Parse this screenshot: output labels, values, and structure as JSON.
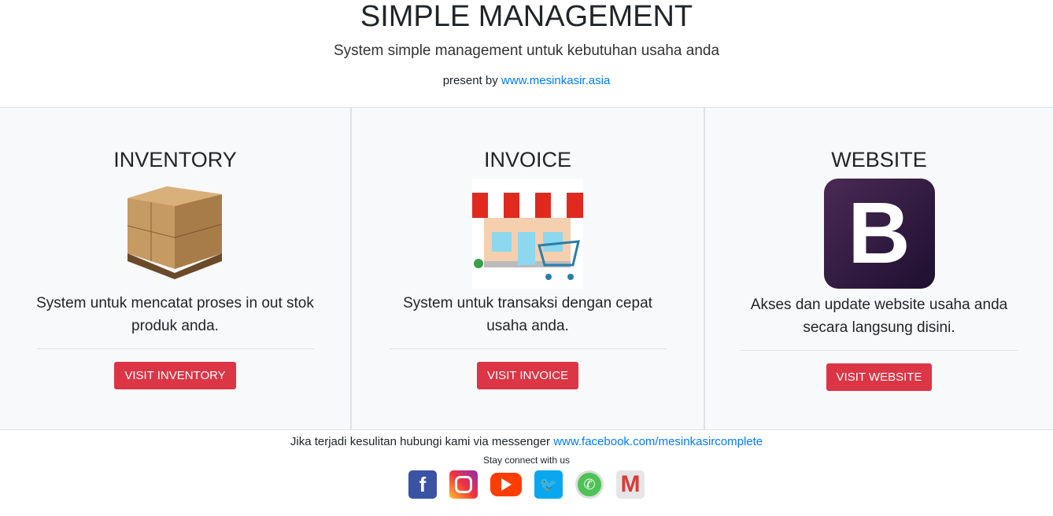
{
  "header": {
    "title": "SIMPLE MANAGEMENT",
    "subtitle": "System simple management untuk kebutuhan usaha anda",
    "present_by": "present by",
    "link": "www.mesinkasir.asia"
  },
  "cards": [
    {
      "title": "INVENTORY",
      "desc": "System untuk mencatat proses in out stok produk anda.",
      "button": "VISIT INVENTORY",
      "image": "boxes-on-pallet"
    },
    {
      "title": "INVOICE",
      "desc": "System untuk transaksi dengan cepat usaha anda.",
      "button": "VISIT INVOICE",
      "image": "store-with-cart"
    },
    {
      "title": "WEBSITE",
      "desc": "Akses dan update website usaha anda secara langsung disini.",
      "button": "VISIT WEBSITE",
      "image": "bootstrap-logo",
      "logo_letter": "B"
    }
  ],
  "footer": {
    "contact_text": "Jika terjadi kesulitan hubungi kami via messenger",
    "contact_link": "www.facebook.com/mesinkasircomplete",
    "stay": "Stay connect with us",
    "social": [
      "facebook-icon",
      "instagram-icon",
      "youtube-icon",
      "twitter-icon",
      "whatsapp-icon",
      "gmail-icon"
    ]
  },
  "colors": {
    "accent": "#dc3545",
    "link": "#007bff"
  }
}
